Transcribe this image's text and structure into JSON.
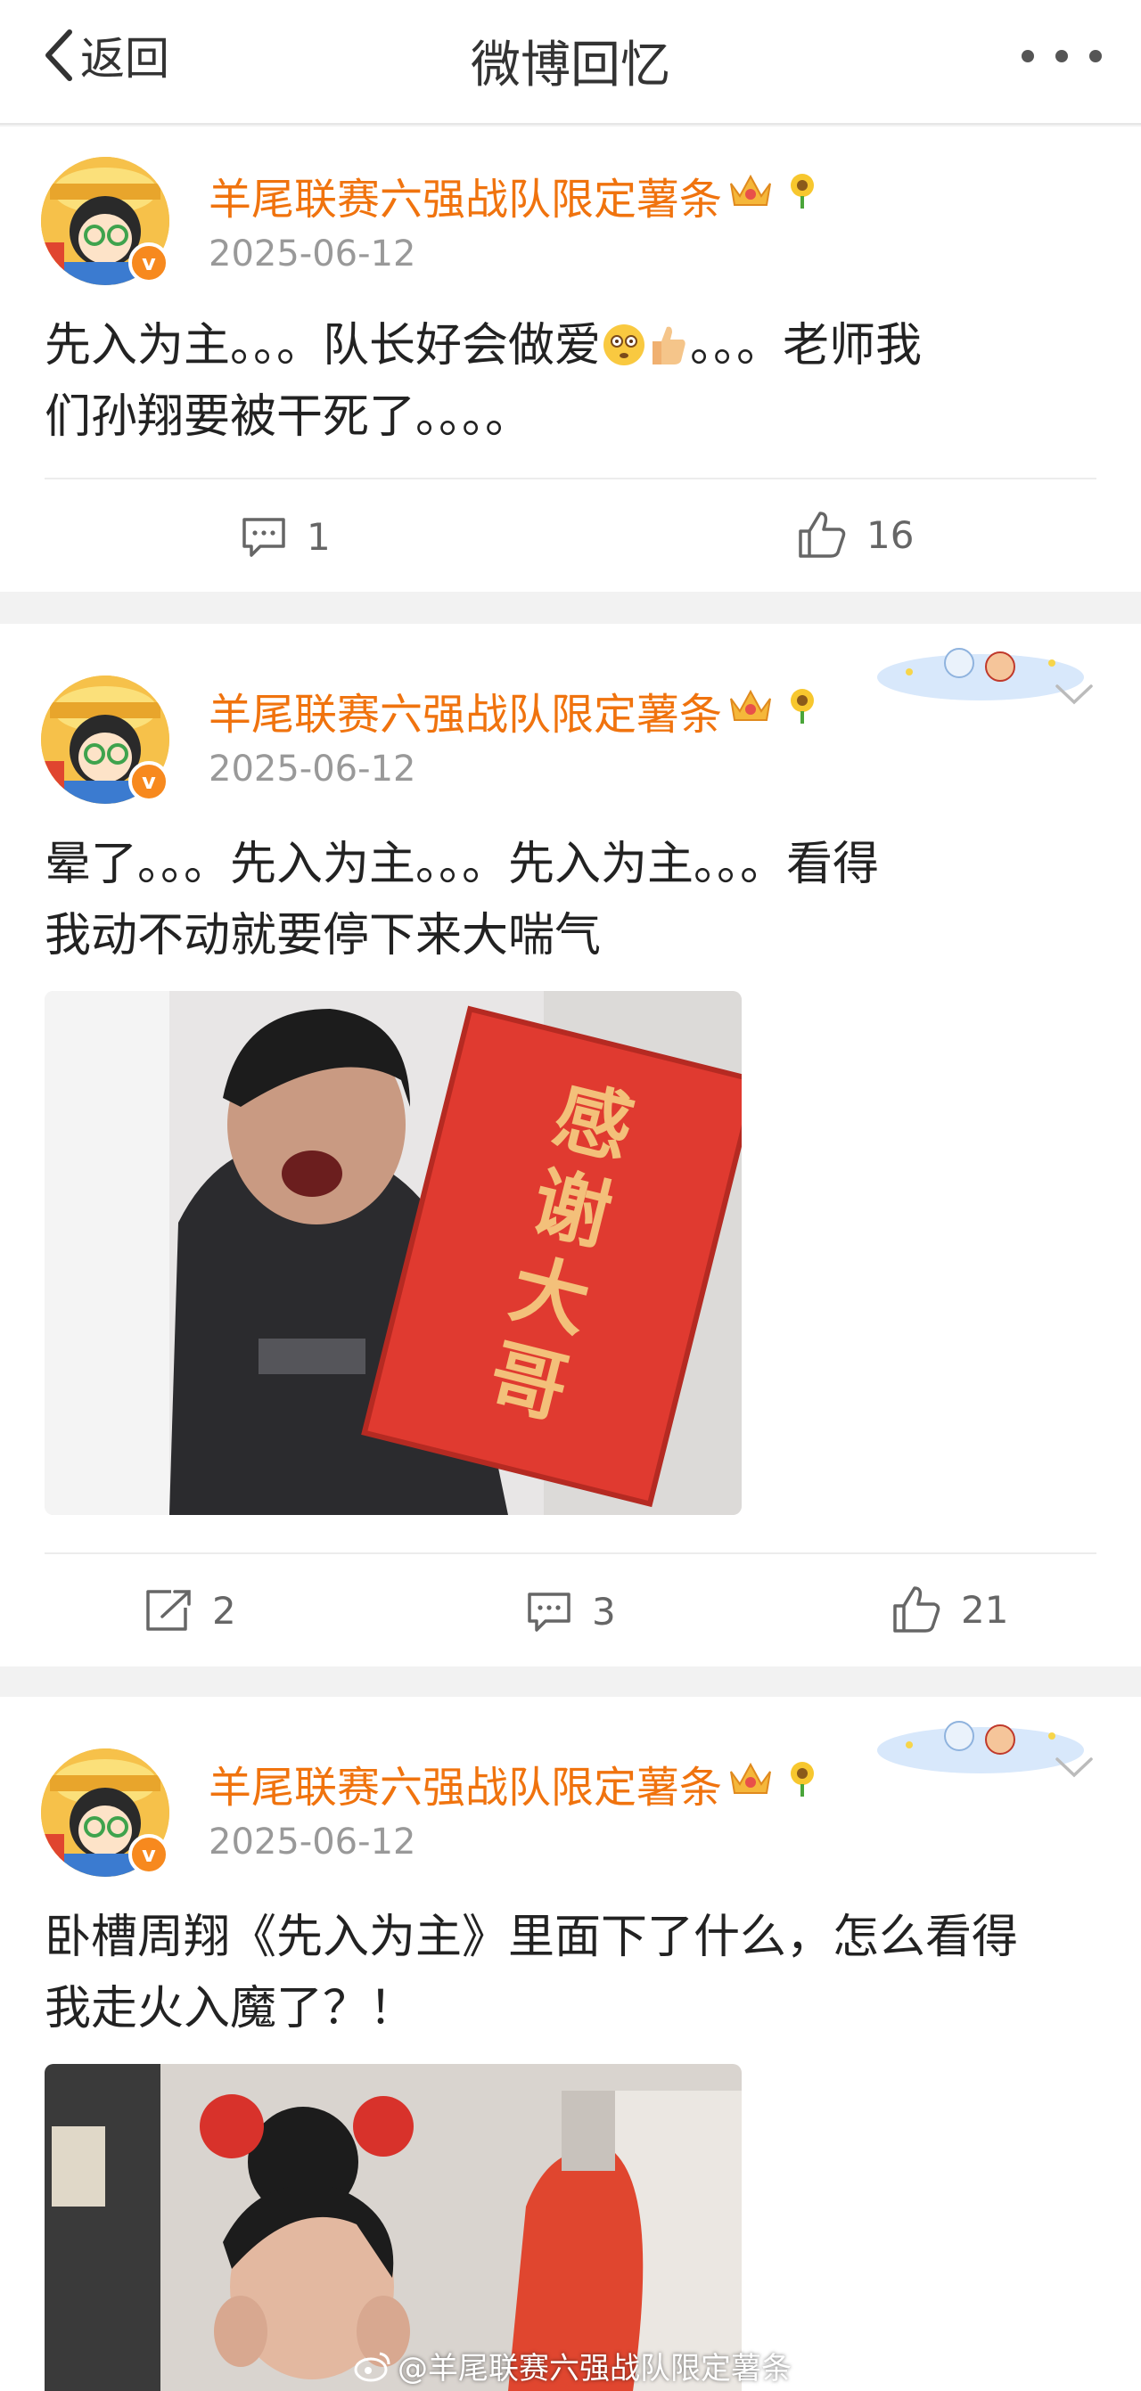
{
  "header": {
    "back_label": "返回",
    "title": "微博回忆"
  },
  "posts": [
    {
      "username": "羊尾联赛六强战队限定薯条",
      "date": "2025-06-12",
      "text_line1": "先入为主。。。队长好会做爱",
      "text_line1_tail": "。。。老师我",
      "text_line2": "们孙翔要被干死了。。。。",
      "comments": "1",
      "likes": "16"
    },
    {
      "username": "羊尾联赛六强战队限定薯条",
      "date": "2025-06-12",
      "text_line1": "晕了。。。先入为主。。。先入为主。。。看得",
      "text_line2": "我动不动就要停下来大喘气",
      "sign_text": "感谢大哥",
      "reposts": "2",
      "comments": "3",
      "likes": "21"
    },
    {
      "username": "羊尾联赛六强战队限定薯条",
      "date": "2025-06-12",
      "text_line1": "卧槽周翔《先入为主》里面下了什么，怎么看得",
      "text_line2": "我走火入魔了？！"
    }
  ],
  "watermark": "@羊尾联赛六强战队限定薯条",
  "colors": {
    "username": "#f0730e",
    "verified_badge": "#f7891e",
    "date": "#999999",
    "sign_red": "#e03a30"
  },
  "icons": [
    "chevron-left-icon",
    "more-dots-icon",
    "verified-badge-icon",
    "crown-icon",
    "sunflower-icon",
    "comment-icon",
    "like-icon",
    "repost-icon",
    "chevron-down-icon",
    "weibo-logo-icon"
  ]
}
